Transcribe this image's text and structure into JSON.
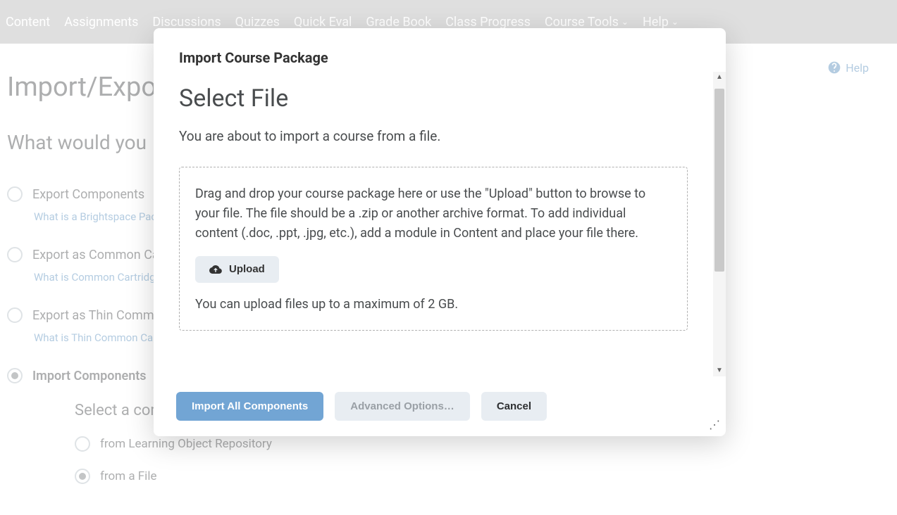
{
  "nav": {
    "items": [
      {
        "label": "Content",
        "dropdown": false
      },
      {
        "label": "Assignments",
        "dropdown": false
      },
      {
        "label": "Discussions",
        "dropdown": false
      },
      {
        "label": "Quizzes",
        "dropdown": false
      },
      {
        "label": "Quick Eval",
        "dropdown": false
      },
      {
        "label": "Grade Book",
        "dropdown": false
      },
      {
        "label": "Class Progress",
        "dropdown": false
      },
      {
        "label": "Course Tools",
        "dropdown": true
      },
      {
        "label": "Help",
        "dropdown": true
      }
    ]
  },
  "help_link": "Help",
  "page": {
    "title": "Import/Expo",
    "subtitle": "What would you",
    "options": [
      {
        "label": "Export Components",
        "help": "What is a Brightspace Packag"
      },
      {
        "label": "Export as Common Cart",
        "help": "What is Common Cartridge?"
      },
      {
        "label": "Export as Thin Common",
        "help": "What is Thin Common Cartri"
      }
    ],
    "import_option": "Import Components",
    "sub_title": "Select a comp",
    "sub_options": [
      {
        "label": "from Learning Object Repository",
        "checked": false
      },
      {
        "label": "from a File",
        "checked": true
      }
    ]
  },
  "modal": {
    "header": "Import Course Package",
    "sf_title": "Select File",
    "sf_desc": "You are about to import a course from a file.",
    "dz_instr": "Drag and drop your course package here or use the \"Upload\" button to browse to your file. The file should be a .zip or another archive format. To add individual content (.doc, .ppt, .jpg, etc.), add a module in Content and place your file there.",
    "upload_label": "Upload",
    "dz_limit": "You can upload files up to a maximum of 2 GB.",
    "buttons": {
      "primary": "Import All Components",
      "secondary": "Advanced Options…",
      "cancel": "Cancel"
    }
  }
}
